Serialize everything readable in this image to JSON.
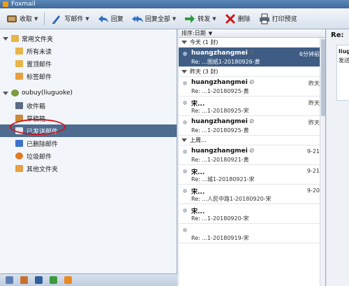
{
  "window": {
    "title": "Foxmail"
  },
  "toolbar": {
    "receive": "收取",
    "compose": "写邮件",
    "reply": "回复",
    "reply_all": "回复全部",
    "forward": "转发",
    "delete": "删除",
    "print_preview": "打印预览"
  },
  "sidebar": {
    "common_group": "常用文件夹",
    "common_items": [
      {
        "label": "所有未读"
      },
      {
        "label": "置顶邮件"
      },
      {
        "label": "标签邮件"
      }
    ],
    "account": "oubuy(liuguoke)",
    "account_items": [
      {
        "label": "收件箱"
      },
      {
        "label": "草稿箱"
      },
      {
        "label": "已发送邮件"
      },
      {
        "label": "已删除邮件"
      },
      {
        "label": "垃圾邮件"
      },
      {
        "label": "其他文件夹"
      }
    ]
  },
  "list": {
    "sort_label": "排序:日期",
    "groups": [
      {
        "header": "今天 (1 封)",
        "messages": [
          {
            "sender": "huangzhangmei",
            "subject": "Re: ...图纸1-20180926-黄",
            "time": "6分钟前"
          }
        ]
      },
      {
        "header": "昨天 (3 封)",
        "messages": [
          {
            "sender": "huangzhangmei",
            "subject": "Re: ...1-20180925-黄",
            "time": "昨天"
          },
          {
            "sender": "宋...",
            "subject": "Re: ...1-20180925-宋",
            "time": "昨天"
          },
          {
            "sender": "huangzhangmei",
            "subject": "Re: ...1-20180925-黄",
            "time": "昨天"
          }
        ]
      },
      {
        "header": "上周...",
        "messages": [
          {
            "sender": "huangzhangmei",
            "subject": "Re: ...1-20180921-黄",
            "time": "9-21"
          },
          {
            "sender": "宋...",
            "subject": "Re: ...城1-20180921-宋",
            "time": "9-21"
          },
          {
            "sender": "宋...",
            "subject": "Re: ...人民中路1-20180920-宋",
            "time": "9-20"
          },
          {
            "sender": "宋...",
            "subject": "Re: ...1-20180920-宋",
            "time": ""
          },
          {
            "sender": "",
            "subject": "Re: ...1-20180919-宋",
            "time": ""
          }
        ]
      }
    ]
  },
  "reading": {
    "title_prefix": "Re:",
    "from_prefix": "liug",
    "send_prefix": "发送"
  }
}
